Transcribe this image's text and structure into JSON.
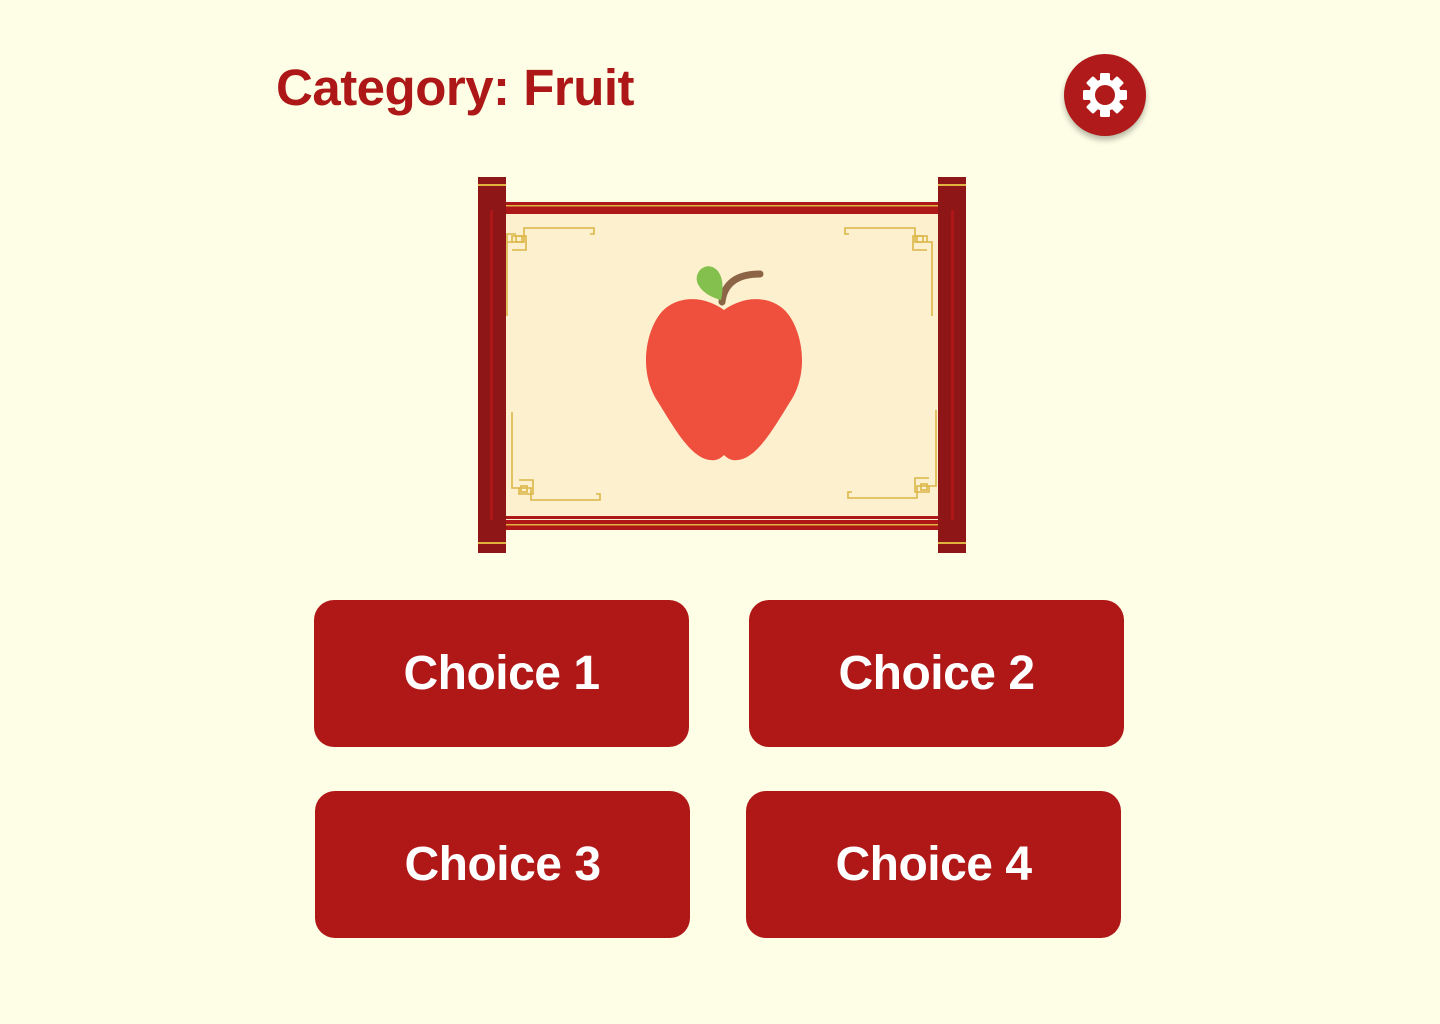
{
  "header": {
    "category_label": "Category: Fruit"
  },
  "settings": {
    "icon": "gear-icon"
  },
  "prompt": {
    "picture": "apple-icon"
  },
  "choices": [
    {
      "label": "Choice 1"
    },
    {
      "label": "Choice 2"
    },
    {
      "label": "Choice 3"
    },
    {
      "label": "Choice 4"
    }
  ],
  "colors": {
    "background": "#fefee6",
    "accent": "#b01818",
    "scroll_paper": "#fdf0cf",
    "ornament_gold": "#dcb646",
    "apple_red": "#ee503d",
    "leaf_green": "#84c04d",
    "stem_brown": "#8c6546"
  }
}
